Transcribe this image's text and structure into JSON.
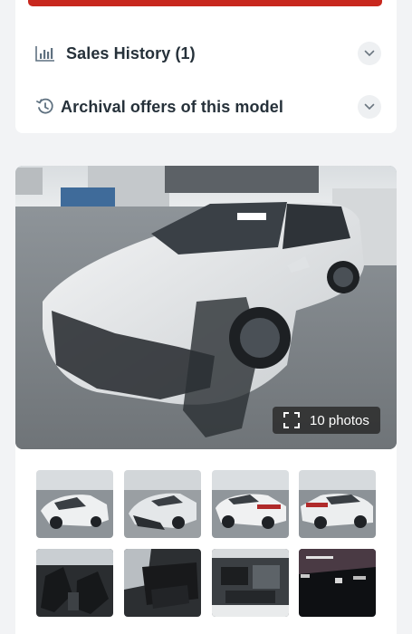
{
  "accordion": {
    "sales_history_label": "Sales History (1)",
    "archival_offers_label": "Archival offers of this model"
  },
  "gallery": {
    "photos_label": "10 photos",
    "thumbnails": [
      {
        "name": "thumb-front-left"
      },
      {
        "name": "thumb-front-right-damage"
      },
      {
        "name": "thumb-rear-left"
      },
      {
        "name": "thumb-rear-right"
      },
      {
        "name": "thumb-front-seats"
      },
      {
        "name": "thumb-rear-seats"
      },
      {
        "name": "thumb-engine-bay"
      },
      {
        "name": "thumb-dashboard"
      }
    ]
  },
  "colors": {
    "accent_red": "#c8281e",
    "icon_gray": "#5f7180",
    "car_body": "#e6e8ea"
  },
  "icons": [
    "bar-chart-icon",
    "history-icon",
    "chevron-down-icon",
    "fullscreen-icon"
  ]
}
